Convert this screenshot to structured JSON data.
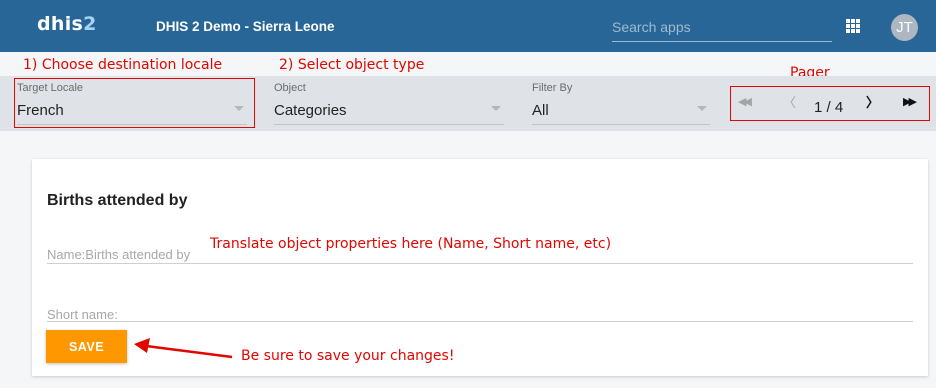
{
  "header": {
    "logo_main": "dhis",
    "logo_number": "2",
    "instance_title": "DHIS 2 Demo - Sierra Leone",
    "search_placeholder": "Search apps",
    "avatar_initials": "JT"
  },
  "annotations": {
    "choose_locale": "1) Choose destination locale",
    "select_type": "2) Select object type",
    "pager": "Pager",
    "translate_here": "Translate object properties here (Name, Short name, etc)",
    "save_reminder": "Be sure to save your changes!"
  },
  "filters": {
    "target_locale": {
      "label": "Target Locale",
      "value": "French"
    },
    "object": {
      "label": "Object",
      "value": "Categories"
    },
    "filter_by": {
      "label": "Filter By",
      "value": "All"
    }
  },
  "pager": {
    "first": "◀◀",
    "prev": "〈",
    "page_text": "1 / 4",
    "next": "〉",
    "last": "▶▶"
  },
  "card": {
    "title": "Births attended by",
    "name_label": "Name:Births attended by",
    "short_name_label": "Short name:",
    "save_label": "SAVE"
  },
  "colors": {
    "header": "#276696",
    "accent_save": "#ff9800",
    "annotation": "#e10600"
  }
}
